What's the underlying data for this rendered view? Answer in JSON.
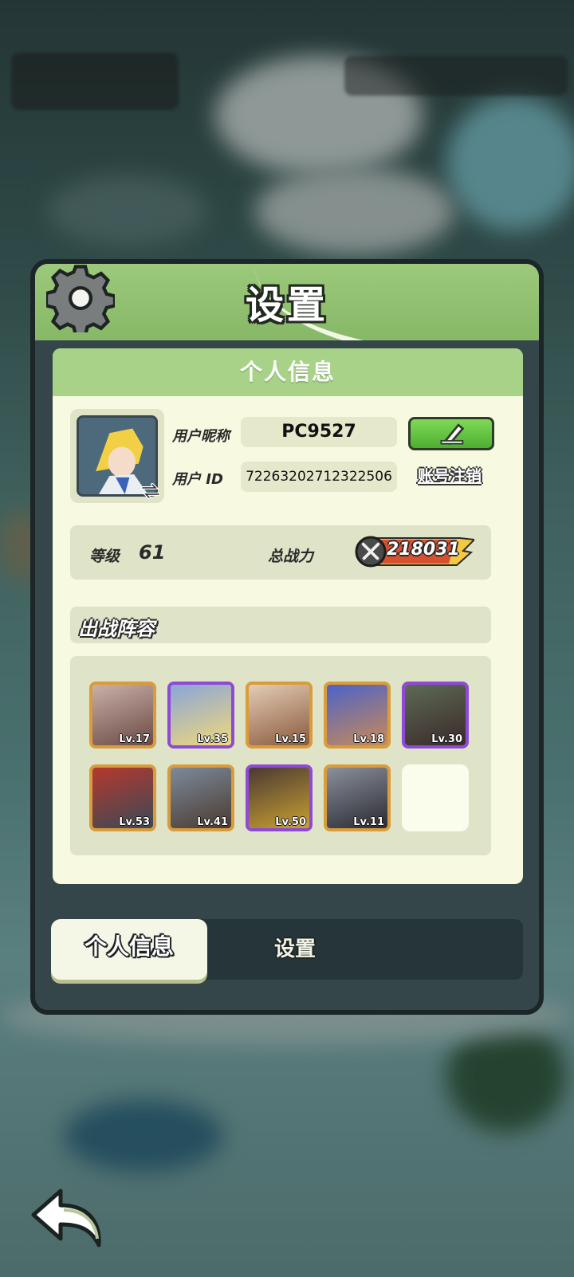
{
  "panel": {
    "title": "设置"
  },
  "profile": {
    "section_title": "个人信息",
    "nickname_label": "用户昵称",
    "nickname": "PC9527",
    "id_label": "用户 ID",
    "user_id": "72263202712322506",
    "cancel_account": "账号注销"
  },
  "stats": {
    "level_label": "等级",
    "level": "61",
    "power_label": "总战力",
    "power": "218031"
  },
  "lineup": {
    "title": "出战阵容",
    "heroes": [
      {
        "level": "Lv.17",
        "rarity": "gold",
        "color": "#c8b0a8"
      },
      {
        "level": "Lv.35",
        "rarity": "purple",
        "color": "#8aa6d8"
      },
      {
        "level": "Lv.15",
        "rarity": "gold",
        "color": "#e3ccb6"
      },
      {
        "level": "Lv.18",
        "rarity": "gold",
        "color": "#4b63c9"
      },
      {
        "level": "Lv.30",
        "rarity": "purple",
        "color": "#5d6a55"
      },
      {
        "level": "Lv.53",
        "rarity": "gold",
        "color": "#b5382e"
      },
      {
        "level": "Lv.41",
        "rarity": "gold",
        "color": "#7c8a9a"
      },
      {
        "level": "Lv.50",
        "rarity": "purple",
        "color": "#4a3a33"
      },
      {
        "level": "Lv.11",
        "rarity": "gold",
        "color": "#8a8f9a"
      }
    ]
  },
  "tabs": {
    "active": "个人信息",
    "other": "设置"
  },
  "icons": [
    "gear-icon",
    "swap-icon",
    "pencil-icon",
    "sword-icon",
    "back-arrow-icon"
  ]
}
